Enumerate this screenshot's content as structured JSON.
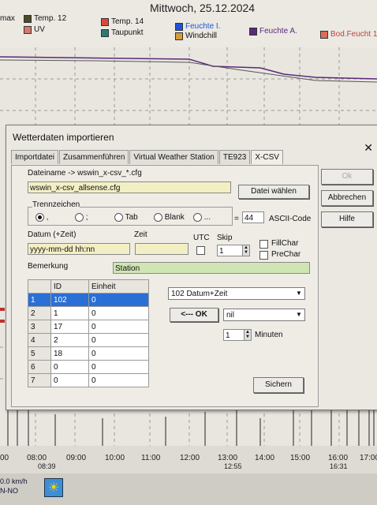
{
  "app": {
    "date_title": "Mittwoch, 25.12.2024",
    "legend": [
      {
        "label": "max",
        "color": ""
      },
      {
        "label": "Temp. 12",
        "color": "#4a4a2a"
      },
      {
        "label": "Temp. 14",
        "color": "#e0453a"
      },
      {
        "label": "Feuchte I.",
        "color": "#1b55d8"
      },
      {
        "label": "Feuchte A.",
        "color": "#5a2a7a"
      },
      {
        "label": "Bod.Feucht 1",
        "color": "#e06a5a"
      },
      {
        "label": "UV",
        "color": "#d8786a"
      },
      {
        "label": "Taupunkt",
        "color": "#2b7a70"
      },
      {
        "label": "Windchill",
        "color": "#d69a3a"
      }
    ],
    "x_ticks": [
      "00",
      "08:00",
      "09:00",
      "10:00",
      "11:00",
      "12:00",
      "13:00",
      "14:00",
      "15:00",
      "16:00",
      "17:00"
    ],
    "x_sub": [
      "08:39",
      "12:55",
      "16:31"
    ],
    "wind_speed": "0.0 km/h",
    "wind_dir": "N-NO"
  },
  "dialog": {
    "title": "Wetterdaten importieren",
    "close": "✕",
    "tabs": [
      "Importdatei",
      "Zusammenführen",
      "Virtual Weather Station",
      "TE923",
      "X-CSV"
    ],
    "filename_label": "Dateiname -> wswin_x-csv_*.cfg",
    "filename_value": "wswin_x-csv_allsense.cfg",
    "choose_file": "Datei wählen",
    "ok": "Ok",
    "cancel": "Abbrechen",
    "help": "Hilfe",
    "separator_label": "Trennzeichen",
    "sep_options": [
      ",",
      ";",
      "Tab",
      "Blank",
      "..."
    ],
    "eq": "=",
    "ascii_value": "44",
    "ascii_label": "ASCII-Code",
    "date_label": "Datum (+Zeit)",
    "date_value": "yyyy-mm-dd hh:nn",
    "time_label": "Zeit",
    "utc_label": "UTC",
    "skip_label": "Skip",
    "skip_value": "1",
    "fillchar": "FillChar",
    "prechar": "PreChar",
    "remark_label": "Bemerkung",
    "remark_value": "Station",
    "table_headers": [
      "ID",
      "Einheit"
    ],
    "rows": [
      {
        "n": "1",
        "id": "102",
        "unit": "0"
      },
      {
        "n": "2",
        "id": "1",
        "unit": "0"
      },
      {
        "n": "3",
        "id": "17",
        "unit": "0"
      },
      {
        "n": "4",
        "id": "2",
        "unit": "0"
      },
      {
        "n": "5",
        "id": "18",
        "unit": "0"
      },
      {
        "n": "6",
        "id": "0",
        "unit": "0"
      },
      {
        "n": "7",
        "id": "0",
        "unit": "0"
      }
    ],
    "field_select": "102 Datum+Zeit",
    "ok_arrow": "<--- OK",
    "nil_select": "nil",
    "minutes_value": "1",
    "minutes_label": "Minuten",
    "save": "Sichern"
  }
}
